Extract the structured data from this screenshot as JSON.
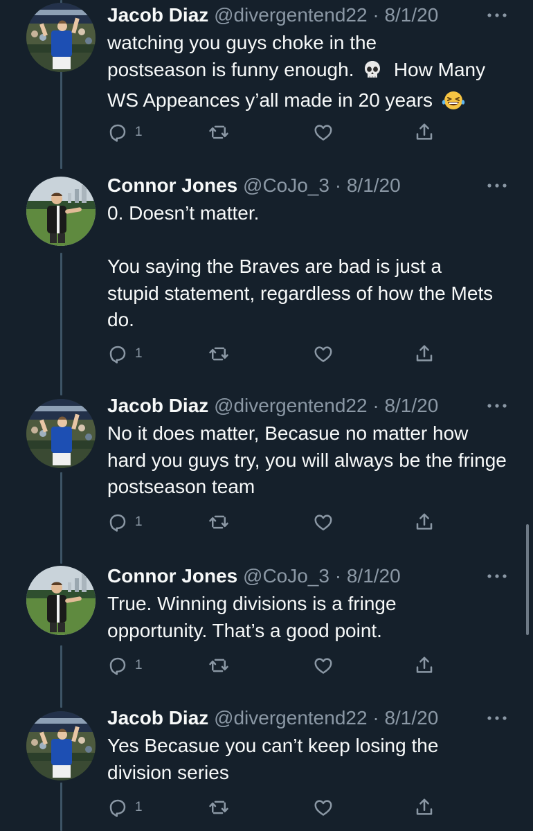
{
  "tweets": [
    {
      "name": "Jacob Diaz",
      "handle": "@divergentend22",
      "separator": "·",
      "date": "8/1/20",
      "line1": "watching  you guys choke in the",
      "line2a": "postseason is funny enough.",
      "line2b": "How Many",
      "line3": "WS Appeances y’all made in 20 years",
      "emoji_1": "skull",
      "emoji_2": "face-with-tears-of-joy",
      "reply_count": "1"
    },
    {
      "name": "Connor Jones",
      "handle": "@CoJo_3",
      "separator": "·",
      "date": "8/1/20",
      "para1": "0. Doesn’t matter.",
      "para2": "You saying the Braves are bad is just a stupid statement, regardless of how the Mets do.",
      "reply_count": "1"
    },
    {
      "name": "Jacob Diaz",
      "handle": "@divergentend22",
      "separator": "·",
      "date": "8/1/20",
      "text": "No it does matter, Becasue no matter how hard you guys try, you will always be the fringe postseason team",
      "reply_count": "1"
    },
    {
      "name": "Connor Jones",
      "handle": "@CoJo_3",
      "separator": "·",
      "date": "8/1/20",
      "text": "True. Winning divisions is a fringe opportunity. That’s a good point.",
      "reply_count": "1"
    },
    {
      "name": "Jacob Diaz",
      "handle": "@divergentend22",
      "separator": "·",
      "date": "8/1/20",
      "text": "Yes Becasue you can’t keep losing the division series",
      "reply_count": "1"
    }
  ],
  "avatar_jersey_number": "20",
  "colors": {
    "background": "#15202b",
    "text_primary": "#f7f9f9",
    "text_secondary": "#8b98a5",
    "thread_line": "#3d5466"
  },
  "icons": [
    "reply-icon",
    "retweet-icon",
    "like-icon",
    "share-icon",
    "more-icon"
  ]
}
